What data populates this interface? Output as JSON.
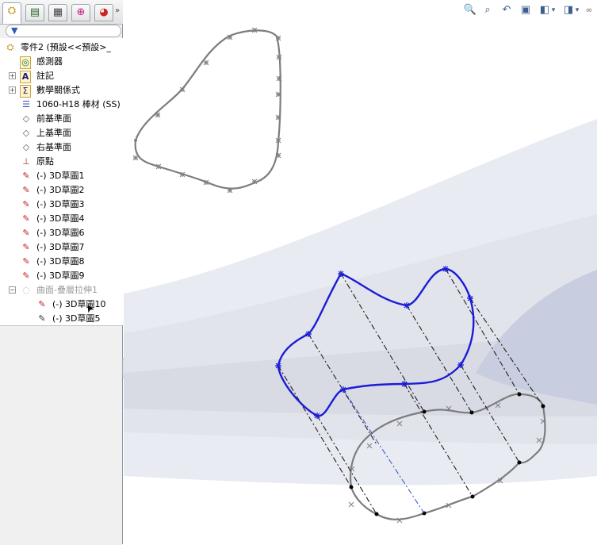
{
  "feature_manager": {
    "tabs": [
      {
        "icon": "part-tree-icon",
        "glyph": "⛭"
      },
      {
        "icon": "property-manager-icon",
        "glyph": "▤"
      },
      {
        "icon": "configuration-manager-icon",
        "glyph": "▦"
      },
      {
        "icon": "dimxpert-icon",
        "glyph": "⊕"
      },
      {
        "icon": "display-manager-icon",
        "glyph": "◕"
      }
    ],
    "tab_more": "»",
    "filter_icon_glyph": "▼",
    "tree": {
      "root": {
        "label": "零件2  (預設<<預設>_",
        "icon": "part-icon",
        "glyph": "⛭"
      },
      "items": [
        {
          "label": "感測器",
          "icon": "sensor-icon",
          "glyph": "◎",
          "expand": ""
        },
        {
          "label": "註記",
          "icon": "annotation-icon",
          "glyph": "A",
          "expand": "+"
        },
        {
          "label": "數學關係式",
          "icon": "equations-icon",
          "glyph": "Σ",
          "expand": "+"
        },
        {
          "label": "1060-H18 棒材 (SS)",
          "icon": "material-icon",
          "glyph": "☰",
          "expand": ""
        },
        {
          "label": "前基準面",
          "icon": "plane-icon",
          "glyph": "◇",
          "expand": ""
        },
        {
          "label": "上基準面",
          "icon": "plane-icon",
          "glyph": "◇",
          "expand": ""
        },
        {
          "label": "右基準面",
          "icon": "plane-icon",
          "glyph": "◇",
          "expand": ""
        },
        {
          "label": "原點",
          "icon": "origin-icon",
          "glyph": "⊥",
          "expand": ""
        },
        {
          "label": "(-) 3D草圖1",
          "icon": "3d-sketch-icon",
          "glyph": "✎",
          "expand": ""
        },
        {
          "label": "(-) 3D草圖2",
          "icon": "3d-sketch-icon",
          "glyph": "✎",
          "expand": ""
        },
        {
          "label": "(-) 3D草圖3",
          "icon": "3d-sketch-icon",
          "glyph": "✎",
          "expand": ""
        },
        {
          "label": "(-) 3D草圖4",
          "icon": "3d-sketch-icon",
          "glyph": "✎",
          "expand": ""
        },
        {
          "label": "(-) 3D草圖6",
          "icon": "3d-sketch-icon",
          "glyph": "✎",
          "expand": ""
        },
        {
          "label": "(-) 3D草圖7",
          "icon": "3d-sketch-icon",
          "glyph": "✎",
          "expand": ""
        },
        {
          "label": "(-) 3D草圖8",
          "icon": "3d-sketch-icon",
          "glyph": "✎",
          "expand": ""
        },
        {
          "label": "(-) 3D草圖9",
          "icon": "3d-sketch-icon",
          "glyph": "✎",
          "expand": ""
        }
      ],
      "surface_feature": {
        "label": "曲面-疊層拉伸1",
        "icon": "loft-surface-icon",
        "glyph": "◌",
        "expand": "−"
      },
      "children": [
        {
          "label": "(-) 3D草圖10",
          "icon": "3d-sketch-icon",
          "glyph": "✎"
        },
        {
          "label": "(-) 3D草圖5",
          "icon": "3d-sketch-icon",
          "glyph": "✎"
        }
      ]
    },
    "splitter_glyph": "‹"
  },
  "view_toolbar": [
    {
      "name": "zoom-to-fit-icon",
      "glyph": "🔍"
    },
    {
      "name": "zoom-to-area-icon",
      "glyph": "⌕"
    },
    {
      "name": "previous-view-icon",
      "glyph": "↶"
    },
    {
      "name": "section-view-icon",
      "glyph": "▣"
    },
    {
      "name": "view-orientation-icon",
      "glyph": "◧"
    },
    {
      "name": "display-style-icon",
      "glyph": "◨"
    },
    {
      "name": "hide-show-items-icon",
      "glyph": "∞"
    }
  ],
  "view_toolbar_dropdown": "▾",
  "cursor_glyph": "➤"
}
